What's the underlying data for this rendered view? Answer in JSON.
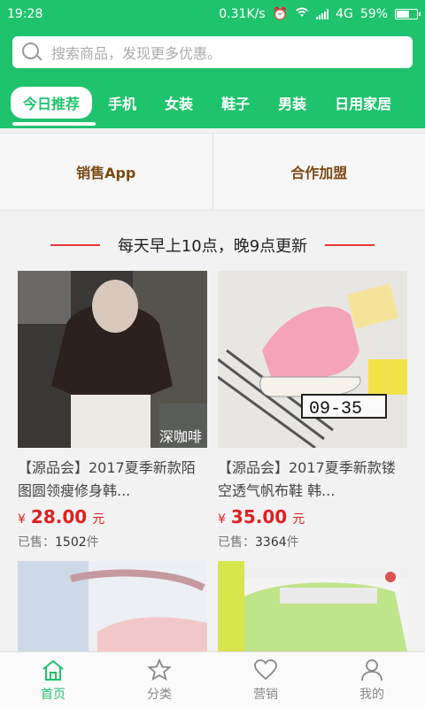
{
  "status_bar": {
    "time": "19:28",
    "net_speed": "0.31K/s",
    "network": "4G",
    "battery": "59%"
  },
  "search": {
    "placeholder": "搜索商品，发现更多优惠。"
  },
  "tabs": [
    {
      "label": "今日推荐"
    },
    {
      "label": "手机"
    },
    {
      "label": "女装"
    },
    {
      "label": "鞋子"
    },
    {
      "label": "男装"
    },
    {
      "label": "日用家居"
    }
  ],
  "quick_links": [
    {
      "label": "销售App"
    },
    {
      "label": "合作加盟"
    }
  ],
  "banner": {
    "text": "每天早上10点，晚9点更新"
  },
  "products": [
    {
      "title": "【源品会】2017夏季新款陌图圆领瘦修身韩...",
      "currency": "¥",
      "price": "28.00",
      "unit": "元",
      "sold_label": "已售：",
      "sold_count": "1502",
      "sold_unit": "件",
      "watermark": "深咖啡"
    },
    {
      "title": "【源品会】2017夏季新款镂空透气帆布鞋 韩...",
      "currency": "¥",
      "price": "35.00",
      "unit": "元",
      "sold_label": "已售：",
      "sold_count": "3364",
      "sold_unit": "件"
    }
  ],
  "bottom_nav": [
    {
      "label": "首页",
      "icon": "home-icon"
    },
    {
      "label": "分类",
      "icon": "star-icon"
    },
    {
      "label": "营销",
      "icon": "heart-icon"
    },
    {
      "label": "我的",
      "icon": "user-icon"
    }
  ],
  "colors": {
    "brand": "#1fc36d",
    "price": "#e02020",
    "quick_link_text": "#7b4a15"
  }
}
